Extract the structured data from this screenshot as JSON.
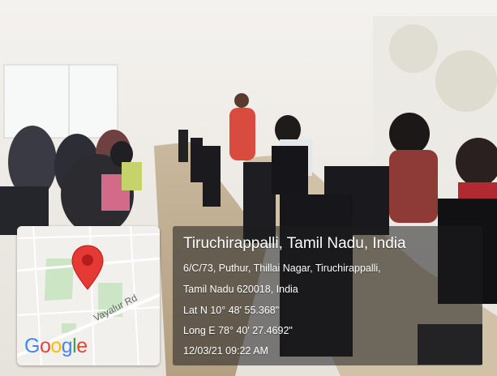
{
  "location": {
    "title": "Tiruchirappalli, Tamil Nadu, India",
    "address_line1": "6/C/73, Puthur, Thillai Nagar, Tiruchirappalli,",
    "address_line2": "Tamil Nadu 620018, India",
    "latitude": "Lat N 10° 48' 55.368\"",
    "longitude": "Long E 78° 40' 27.4692\"",
    "timestamp": "12/03/21 09:22 AM"
  },
  "map": {
    "road_label": "Vayalur Rd",
    "logo_letters": [
      "G",
      "o",
      "o",
      "g",
      "l",
      "e"
    ],
    "logo_colors": [
      "#4285F4",
      "#EA4335",
      "#FBBC05",
      "#4285F4",
      "#34A853",
      "#EA4335"
    ],
    "pin_color": "#E53935",
    "pin_icon": "location-pin-icon"
  }
}
